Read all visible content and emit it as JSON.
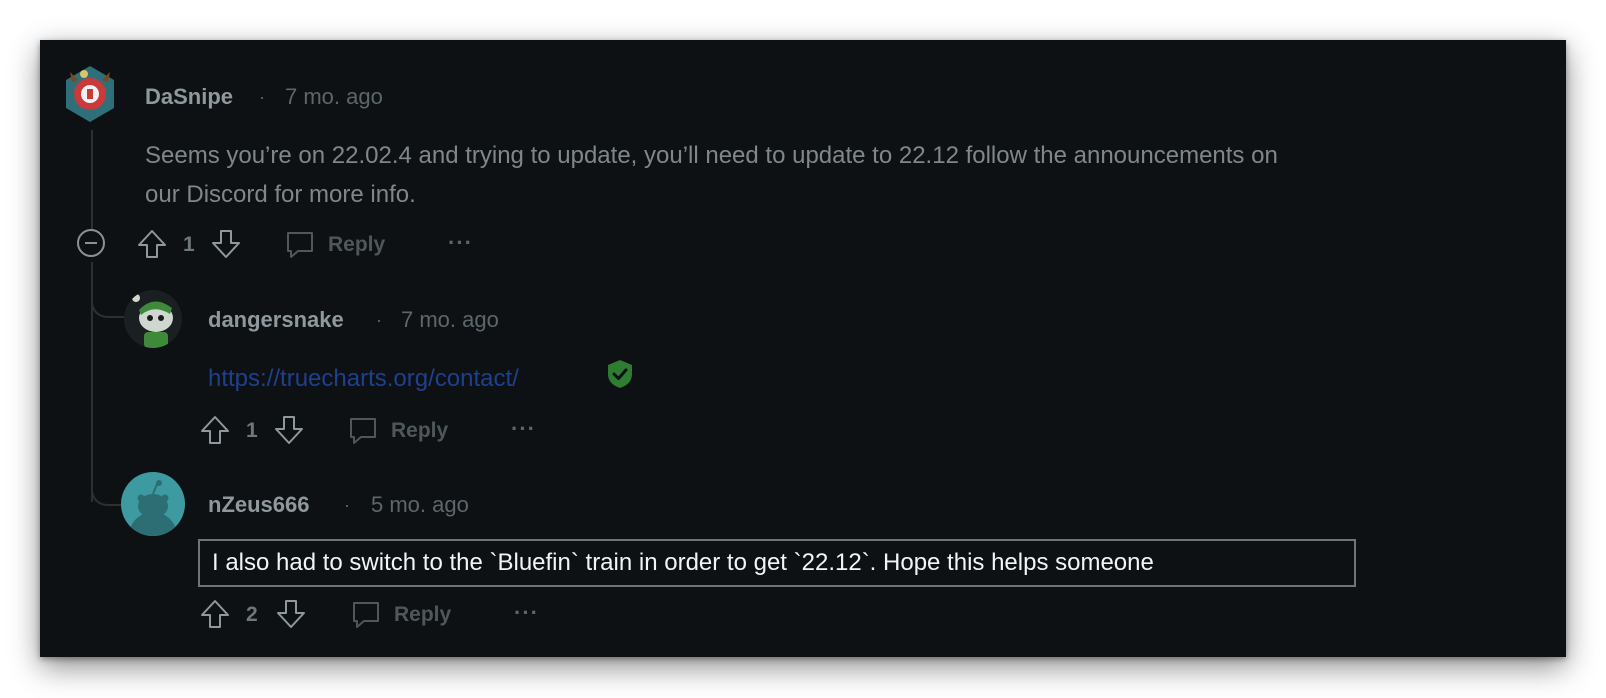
{
  "comments": [
    {
      "author": "DaSnipe",
      "separator": "·",
      "time": "7 mo. ago",
      "body_line1": "Seems you’re on 22.02.4 and trying to update, you’ll need to update to 22.12 follow the announcements on",
      "body_line2": "our Discord for more info.",
      "votes": "1",
      "reply_label": "Reply",
      "more_label": "···"
    },
    {
      "author": "dangersnake",
      "separator": "·",
      "time": "7 mo. ago",
      "link": "https://truecharts.org/contact/",
      "votes": "1",
      "reply_label": "Reply",
      "more_label": "···"
    },
    {
      "author": "nZeus666",
      "separator": "·",
      "time": "5 mo. ago",
      "body": "I also had to switch to the `Bluefin` train in order to get `22.12`. Hope this helps someone",
      "votes": "2",
      "reply_label": "Reply",
      "more_label": "···"
    }
  ],
  "colors": {
    "background": "#0e1113",
    "verified_shield": "#2e7d32",
    "link": "#1f3f8f"
  }
}
